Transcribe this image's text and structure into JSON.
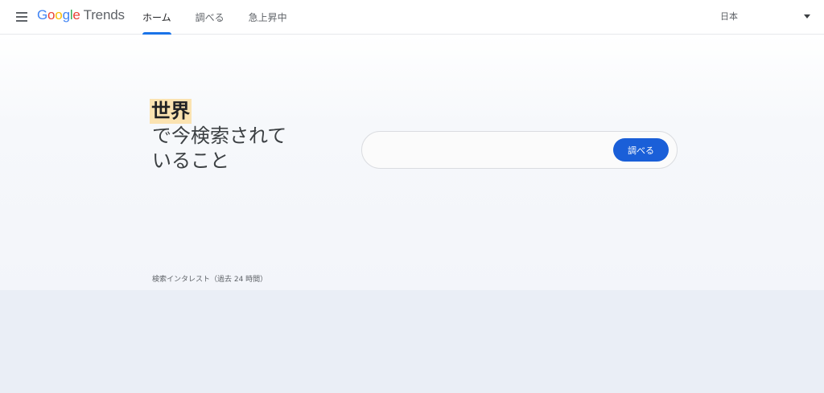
{
  "header": {
    "logo": {
      "google": [
        "G",
        "o",
        "o",
        "g",
        "l",
        "e"
      ],
      "product": "Trends"
    },
    "nav": [
      {
        "label": "ホーム",
        "active": true
      },
      {
        "label": "調べる",
        "active": false
      },
      {
        "label": "急上昇中",
        "active": false
      }
    ],
    "country": "日本",
    "icons": {
      "menu": "hamburger-menu-icon",
      "dropdown": "caret-down-icon"
    }
  },
  "hero": {
    "headline_highlight": "世界",
    "headline_line2": "で今検索されて",
    "headline_line3": "いること",
    "search": {
      "value": "",
      "button_label": "調べる"
    },
    "section_label": "検索インタレスト（過去 24 時間）"
  },
  "colors": {
    "accent": "#1a73e8",
    "button": "#1a5fd8",
    "highlight": "#fbe3b1",
    "lower_band": "#eaeef6"
  }
}
